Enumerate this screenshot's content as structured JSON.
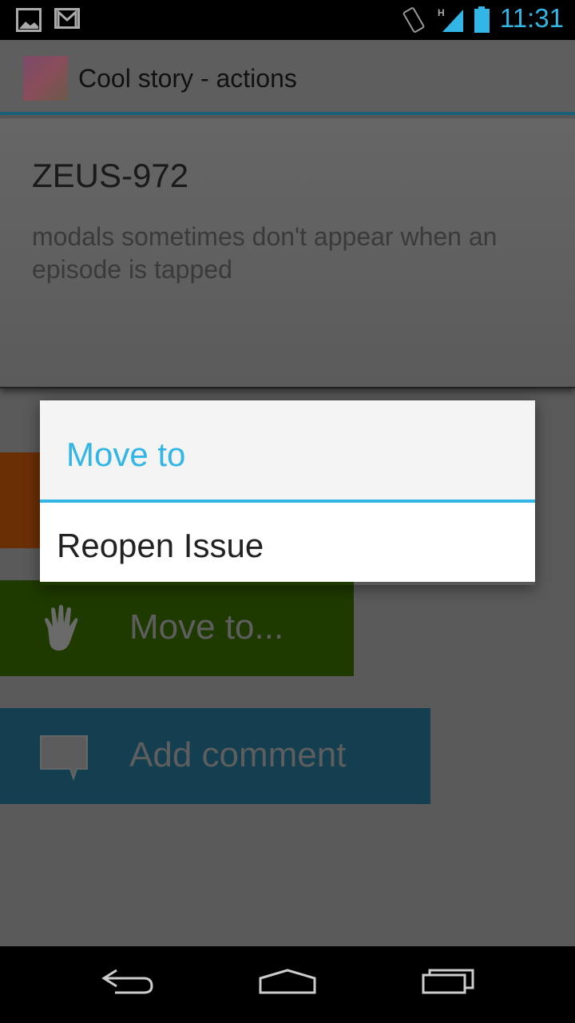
{
  "status_bar": {
    "time": "11:31",
    "network": "H",
    "icons": [
      "image-icon",
      "gmail-icon",
      "vibrate-icon",
      "signal-icon",
      "battery-icon"
    ],
    "accent": "#33b5e5"
  },
  "action_bar": {
    "title": "Cool story - actions",
    "icon": "jira-app-icon"
  },
  "issue": {
    "key": "ZEUS-972",
    "summary": "modals sometimes don't appear when an episode is tapped"
  },
  "actions": [
    {
      "label": "",
      "color": "#6b2f06"
    },
    {
      "label": "Move to...",
      "icon": "hand-icon",
      "color": "#1f3a00"
    },
    {
      "label": "Add comment",
      "icon": "comment-icon",
      "color": "#133f50"
    }
  ],
  "dialog": {
    "title": "Move to",
    "items": [
      "Reopen Issue"
    ]
  },
  "nav_bar": {
    "icons": [
      "back-icon",
      "home-icon",
      "recents-icon"
    ]
  }
}
